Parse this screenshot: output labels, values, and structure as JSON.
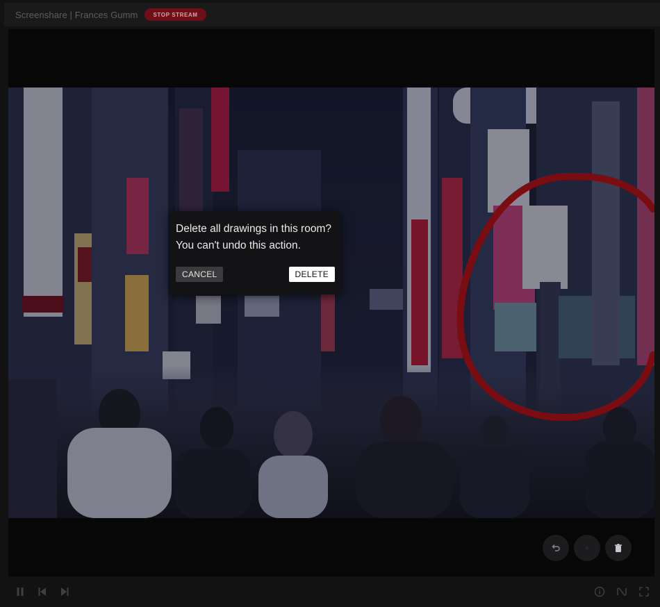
{
  "header": {
    "title": "Screenshare | Frances Gumm",
    "stop_label": "STOP STREAM"
  },
  "dialog": {
    "line1": "Delete all drawings in this room?",
    "line2": "You can't undo this action.",
    "cancel_label": "CANCEL",
    "delete_label": "DELETE"
  },
  "tools": [
    "undo-icon",
    "color-icon",
    "trash-icon"
  ],
  "controls": [
    "pause-icon",
    "prev-icon",
    "next-icon",
    "info-icon",
    "annotate-icon",
    "fullscreen-icon"
  ],
  "colors": {
    "accent": "#6e0e17",
    "drawing": "#7a0d12",
    "background": "#121213"
  }
}
